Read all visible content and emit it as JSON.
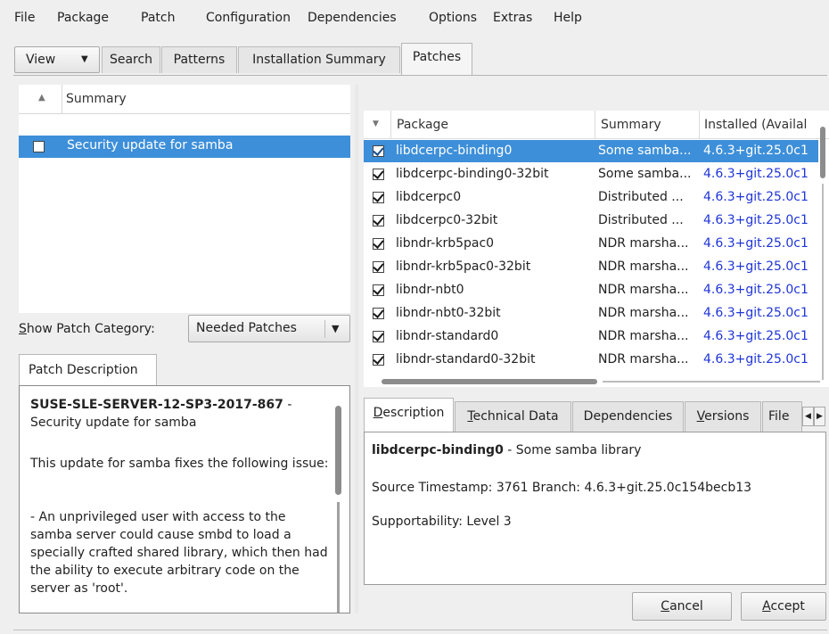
{
  "menubar": {
    "items": [
      "File",
      "Package",
      "Patch",
      "Configuration",
      "Dependencies",
      "Options",
      "Extras",
      "Help"
    ]
  },
  "toolbar": {
    "view_label": "View",
    "tabs": [
      "Search",
      "Patterns",
      "Installation Summary",
      "Patches"
    ],
    "active_tab": "Patches"
  },
  "patch_list": {
    "header": "Summary",
    "rows": [
      {
        "label": "Security update for samba",
        "checked": false,
        "selected": true
      }
    ]
  },
  "patch_category": {
    "label": "Show Patch Category:",
    "selected": "Needed Patches"
  },
  "patch_description": {
    "tab_label": "Patch Description",
    "title_bold": "SUSE-SLE-SERVER-12-SP3-2017-867",
    "title_rest": " - Security update for samba",
    "para1": "This update for samba fixes the following issue:",
    "para2": "- An unprivileged user with access to the samba server could cause smbd to load a specially crafted shared library, which then had the ability to execute arbitrary code on the server as 'root'."
  },
  "package_table": {
    "columns": [
      "Package",
      "Summary",
      "Installed (Availal"
    ],
    "rows": [
      {
        "name": "libdcerpc-binding0",
        "summary": "Some samba...",
        "version": "4.6.3+git.25.0c1",
        "checked": true,
        "selected": true
      },
      {
        "name": "libdcerpc-binding0-32bit",
        "summary": "Some samba...",
        "version": "4.6.3+git.25.0c1",
        "checked": true,
        "selected": false
      },
      {
        "name": "libdcerpc0",
        "summary": "Distributed ...",
        "version": "4.6.3+git.25.0c1",
        "checked": true,
        "selected": false
      },
      {
        "name": "libdcerpc0-32bit",
        "summary": "Distributed ...",
        "version": "4.6.3+git.25.0c1",
        "checked": true,
        "selected": false
      },
      {
        "name": "libndr-krb5pac0",
        "summary": "NDR marsha...",
        "version": "4.6.3+git.25.0c1",
        "checked": true,
        "selected": false
      },
      {
        "name": "libndr-krb5pac0-32bit",
        "summary": "NDR marsha...",
        "version": "4.6.3+git.25.0c1",
        "checked": true,
        "selected": false
      },
      {
        "name": "libndr-nbt0",
        "summary": "NDR marsha...",
        "version": "4.6.3+git.25.0c1",
        "checked": true,
        "selected": false
      },
      {
        "name": "libndr-nbt0-32bit",
        "summary": "NDR marsha...",
        "version": "4.6.3+git.25.0c1",
        "checked": true,
        "selected": false
      },
      {
        "name": "libndr-standard0",
        "summary": "NDR marsha...",
        "version": "4.6.3+git.25.0c1",
        "checked": true,
        "selected": false
      },
      {
        "name": "libndr-standard0-32bit",
        "summary": "NDR marsha...",
        "version": "4.6.3+git.25.0c1",
        "checked": true,
        "selected": false
      }
    ]
  },
  "info_tabs": [
    "Description",
    "Technical Data",
    "Dependencies",
    "Versions",
    "File"
  ],
  "info_active_tab": "Description",
  "package_info": {
    "name": "libdcerpc-binding0",
    "summary_suffix": " - Some samba library",
    "source_line": "Source Timestamp: 3761 Branch: 4.6.3+git.25.0c154becb13",
    "support_line": "Supportability: Level 3"
  },
  "buttons": {
    "cancel": "Cancel",
    "accept": "Accept"
  },
  "colors": {
    "selection": "#3d8fd9",
    "version_link": "#1f35d8"
  }
}
